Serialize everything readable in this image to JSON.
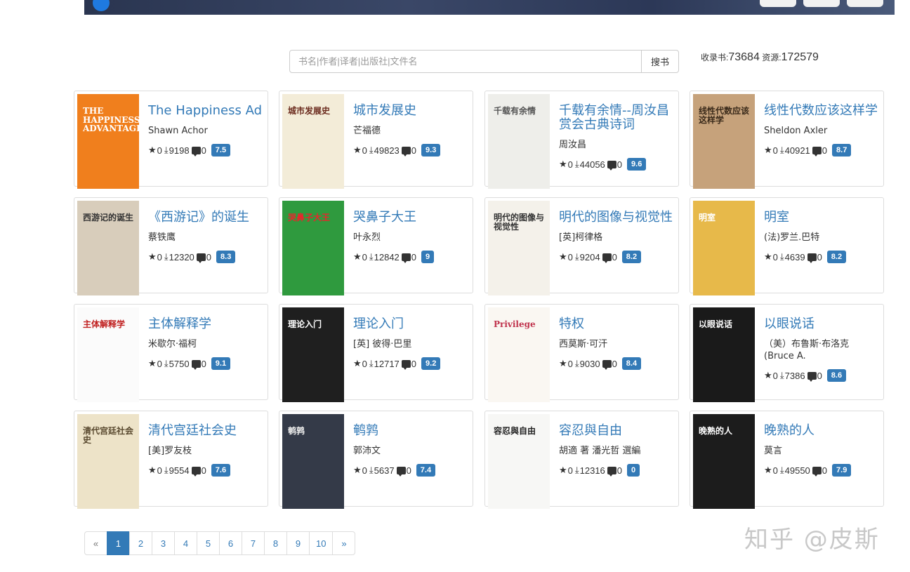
{
  "search": {
    "placeholder": "书名|作者|译者|出版社|文件名",
    "button_label": "搜书"
  },
  "stats": {
    "books_label": "收录书:",
    "books_count": "73684",
    "resources_label": "资源:",
    "resources_count": "172579"
  },
  "books": [
    {
      "title": "The Happiness Ad",
      "author": "Shawn Achor",
      "stars": "0",
      "downloads": "9198",
      "comments": "0",
      "score": "7.5",
      "cover_color": "#f07f1d",
      "cover_text": "THE HAPPINESS ADVANTAGE",
      "cover_text_color": "#ffffff"
    },
    {
      "title": "城市发展史",
      "author": "芒福德",
      "stars": "0",
      "downloads": "49823",
      "comments": "0",
      "score": "9.3",
      "cover_color": "#f3ecd8",
      "cover_text": "城市发展史",
      "cover_text_color": "#6b2b1e"
    },
    {
      "title": "千载有余情--周汝昌赏会古典诗词",
      "author": "周汝昌",
      "stars": "0",
      "downloads": "44056",
      "comments": "0",
      "score": "9.6",
      "cover_color": "#eeeeea",
      "cover_text": "千载有余情",
      "cover_text_color": "#555555"
    },
    {
      "title": "线性代数应该这样学",
      "author": "Sheldon Axler",
      "stars": "0",
      "downloads": "40921",
      "comments": "0",
      "score": "8.7",
      "cover_color": "#c6a27b",
      "cover_text": "线性代数应该这样学",
      "cover_text_color": "#3a2a1a"
    },
    {
      "title": "《西游记》的诞生",
      "author": "蔡铁鹰",
      "stars": "0",
      "downloads": "12320",
      "comments": "0",
      "score": "8.3",
      "cover_color": "#d8cdbb",
      "cover_text": "西游记的诞生",
      "cover_text_color": "#333333"
    },
    {
      "title": "哭鼻子大王",
      "author": "叶永烈",
      "stars": "0",
      "downloads": "12842",
      "comments": "0",
      "score": "9",
      "cover_color": "#2f9a3e",
      "cover_text": "哭鼻子大王",
      "cover_text_color": "#e8262c"
    },
    {
      "title": "明代的图像与视觉性",
      "author": "[英]柯律格",
      "stars": "0",
      "downloads": "9204",
      "comments": "0",
      "score": "8.2",
      "cover_color": "#f4f1ea",
      "cover_text": "明代的图像与视觉性",
      "cover_text_color": "#333333"
    },
    {
      "title": "明室",
      "author": "(法)罗兰.巴特",
      "stars": "0",
      "downloads": "4639",
      "comments": "0",
      "score": "8.2",
      "cover_color": "#e7b94a",
      "cover_text": "明室",
      "cover_text_color": "#ffffff"
    },
    {
      "title": "主体解释学",
      "author": "米歇尔·福柯",
      "stars": "0",
      "downloads": "5750",
      "comments": "0",
      "score": "9.1",
      "cover_color": "#fbfbfb",
      "cover_text": "主体解释学",
      "cover_text_color": "#c02020"
    },
    {
      "title": "理论入门",
      "author": "[英] 彼得·巴里",
      "stars": "0",
      "downloads": "12717",
      "comments": "0",
      "score": "9.2",
      "cover_color": "#1f1f1f",
      "cover_text": "理论入门",
      "cover_text_color": "#ffffff"
    },
    {
      "title": "特权",
      "author": "西莫斯·可汗",
      "stars": "0",
      "downloads": "9030",
      "comments": "0",
      "score": "8.4",
      "cover_color": "#faf7f2",
      "cover_text": "Privilege",
      "cover_text_color": "#c0334d"
    },
    {
      "title": "以眼说话",
      "author": "（美）布鲁斯·布洛克 (Bruce A.",
      "stars": "0",
      "downloads": "7386",
      "comments": "0",
      "score": "8.6",
      "cover_color": "#1a1a1a",
      "cover_text": "以眼说话",
      "cover_text_color": "#ffffff"
    },
    {
      "title": "清代宫廷社会史",
      "author": "[美]罗友枝",
      "stars": "0",
      "downloads": "9554",
      "comments": "0",
      "score": "7.6",
      "cover_color": "#ede3c8",
      "cover_text": "清代宫廷社会史",
      "cover_text_color": "#5a4a30"
    },
    {
      "title": "鹌鹑",
      "author": "郭沛文",
      "stars": "0",
      "downloads": "5637",
      "comments": "0",
      "score": "7.4",
      "cover_color": "#343a48",
      "cover_text": "鹌鹑",
      "cover_text_color": "#e8e8e8"
    },
    {
      "title": "容忍與自由",
      "author": "胡適 著 潘光哲 選編",
      "stars": "0",
      "downloads": "12316",
      "comments": "0",
      "score": "0",
      "cover_color": "#f7f7f5",
      "cover_text": "容忍與自由",
      "cover_text_color": "#222222"
    },
    {
      "title": "晚熟的人",
      "author": "莫言",
      "stars": "0",
      "downloads": "49550",
      "comments": "0",
      "score": "7.9",
      "cover_color": "#1c1c1c",
      "cover_text": "晚熟的人",
      "cover_text_color": "#ffffff"
    }
  ],
  "pagination": {
    "prev": "«",
    "pages": [
      "1",
      "2",
      "3",
      "4",
      "5",
      "6",
      "7",
      "8",
      "9",
      "10"
    ],
    "next": "»",
    "active_page": "1"
  },
  "watermark": "知乎 @皮斯",
  "icons": {
    "star": "star-icon",
    "download": "download-icon",
    "comment": "comment-icon"
  },
  "colors": {
    "link": "#337ab7",
    "score_badge": "#337ab7"
  }
}
